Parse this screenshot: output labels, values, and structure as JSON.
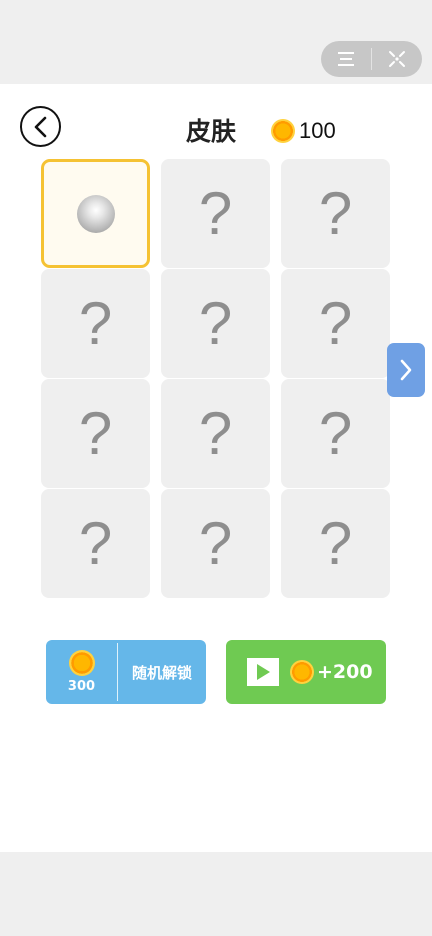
{
  "header": {
    "title": "皮肤",
    "coins": "100"
  },
  "capsule": {
    "menu_icon": "menu-icon",
    "close_icon": "close-target-icon"
  },
  "grid": {
    "rows": 4,
    "cols": 3,
    "selected_index": 0,
    "locked_symbol": "?"
  },
  "actions": {
    "random_unlock": {
      "price": "300",
      "label": "随机解锁"
    },
    "watch_video": {
      "reward": "+200"
    }
  },
  "colors": {
    "selected_border": "#f5c233",
    "random_button": "#65b7e9",
    "video_button": "#6fca52",
    "next_button": "#6fa0e4"
  }
}
